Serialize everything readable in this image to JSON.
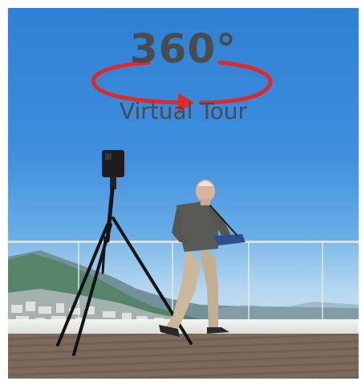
{
  "overlay": {
    "title": "360°",
    "subtitle": "Virtual Tour"
  },
  "colors": {
    "sky": "#3f8fde",
    "rotation_arrow": "#e02a2a",
    "title_text": "#4b4b4b"
  },
  "icons": [
    "rotation-arrow-icon"
  ]
}
